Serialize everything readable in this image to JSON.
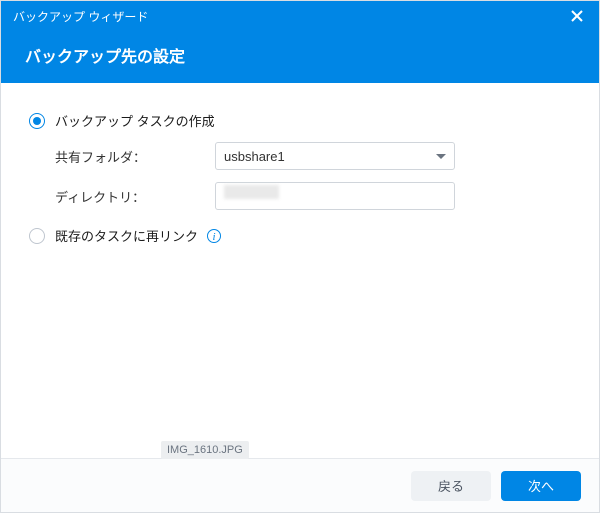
{
  "window": {
    "title": "バックアップ  ウィザード"
  },
  "header": {
    "heading": "バックアップ先の設定"
  },
  "options": {
    "create": {
      "label": "バックアップ タスクの作成",
      "selected": true
    },
    "relink": {
      "label": "既存のタスクに再リンク",
      "selected": false
    }
  },
  "fields": {
    "shared_folder": {
      "label": "共有フォルダ：",
      "value": "usbshare1"
    },
    "directory": {
      "label": "ディレクトリ：",
      "value": ""
    }
  },
  "icons": {
    "info": "info-icon",
    "close": "close-icon",
    "caret": "chevron-down-icon"
  },
  "watermark": {
    "text": "IMG_1610.JPG"
  },
  "footer": {
    "back": "戻る",
    "next": "次へ"
  }
}
